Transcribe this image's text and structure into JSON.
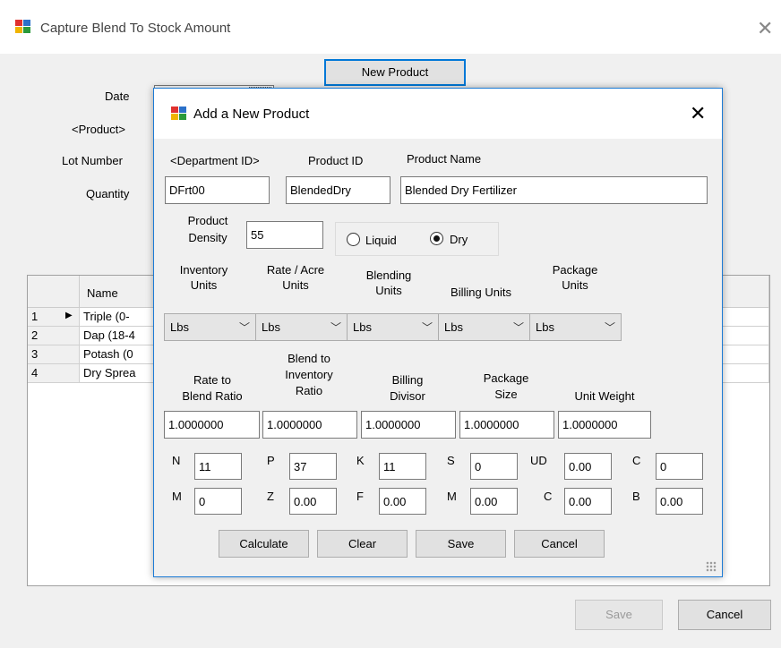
{
  "outer_window": {
    "title": "Capture Blend To Stock Amount",
    "new_product_button": "New Product",
    "labels": {
      "date": "Date",
      "product": "<Product>",
      "lot_number": "Lot Number",
      "quantity": "Quantity"
    },
    "grid": {
      "name_header": "Name",
      "rows": [
        {
          "num": "1",
          "name": "Triple (0-"
        },
        {
          "num": "2",
          "name": "Dap (18-4"
        },
        {
          "num": "3",
          "name": "Potash (0"
        },
        {
          "num": "4",
          "name": "Dry Sprea"
        }
      ]
    },
    "save_button": "Save",
    "cancel_button": "Cancel"
  },
  "dialog": {
    "title": "Add a New Product",
    "headers": {
      "department_id": "<Department ID>",
      "product_id": "Product ID",
      "product_name": "Product Name"
    },
    "values": {
      "department_id": "DFrt00",
      "product_id": "BlendedDry",
      "product_name": "Blended Dry Fertilizer"
    },
    "density": {
      "label_line1": "Product",
      "label_line2": "Density",
      "value": "55"
    },
    "type": {
      "liquid_label": "Liquid",
      "dry_label": "Dry",
      "selected": "Dry"
    },
    "units": {
      "inventory_l1": "Inventory",
      "inventory_l2": "Units",
      "rate_l1": "Rate / Acre",
      "rate_l2": "Units",
      "blending_l1": "Blending",
      "blending_l2": "Units",
      "billing": "Billing Units",
      "package_l1": "Package",
      "package_l2": "Units",
      "inventory_value": "Lbs",
      "rate_value": "Lbs",
      "blending_value": "Lbs",
      "billing_value": "Lbs",
      "package_value": "Lbs"
    },
    "ratios": {
      "rate_l1": "Rate to",
      "rate_l2": "Blend Ratio",
      "blend_l1": "Blend to",
      "blend_l2": "Inventory",
      "blend_l3": "Ratio",
      "billing_l1": "Billing",
      "billing_l2": "Divisor",
      "package_l1": "Package",
      "package_l2": "Size",
      "unit_weight": "Unit Weight",
      "rate_value": "1.0000000",
      "blend_value": "1.0000000",
      "billing_value": "1.0000000",
      "package_value": "1.0000000",
      "unit_weight_value": "1.0000000"
    },
    "nutrients_row1": [
      {
        "label": "N",
        "value": "11"
      },
      {
        "label": "P",
        "value": "37"
      },
      {
        "label": "K",
        "value": "11"
      },
      {
        "label": "S",
        "value": "0"
      },
      {
        "label": "UD",
        "value": "0.00"
      },
      {
        "label": "C",
        "value": "0"
      }
    ],
    "nutrients_row2": [
      {
        "label": "M",
        "value": "0"
      },
      {
        "label": "Z",
        "value": "0.00"
      },
      {
        "label": "F",
        "value": "0.00"
      },
      {
        "label": "M",
        "value": "0.00"
      },
      {
        "label": "C",
        "value": "0.00"
      },
      {
        "label": "B",
        "value": "0.00"
      }
    ],
    "buttons": {
      "calculate": "Calculate",
      "clear": "Clear",
      "save": "Save",
      "cancel": "Cancel"
    }
  },
  "colors": {
    "dialog_border": "#1c7bd6",
    "focus_border": "#0078d7"
  }
}
